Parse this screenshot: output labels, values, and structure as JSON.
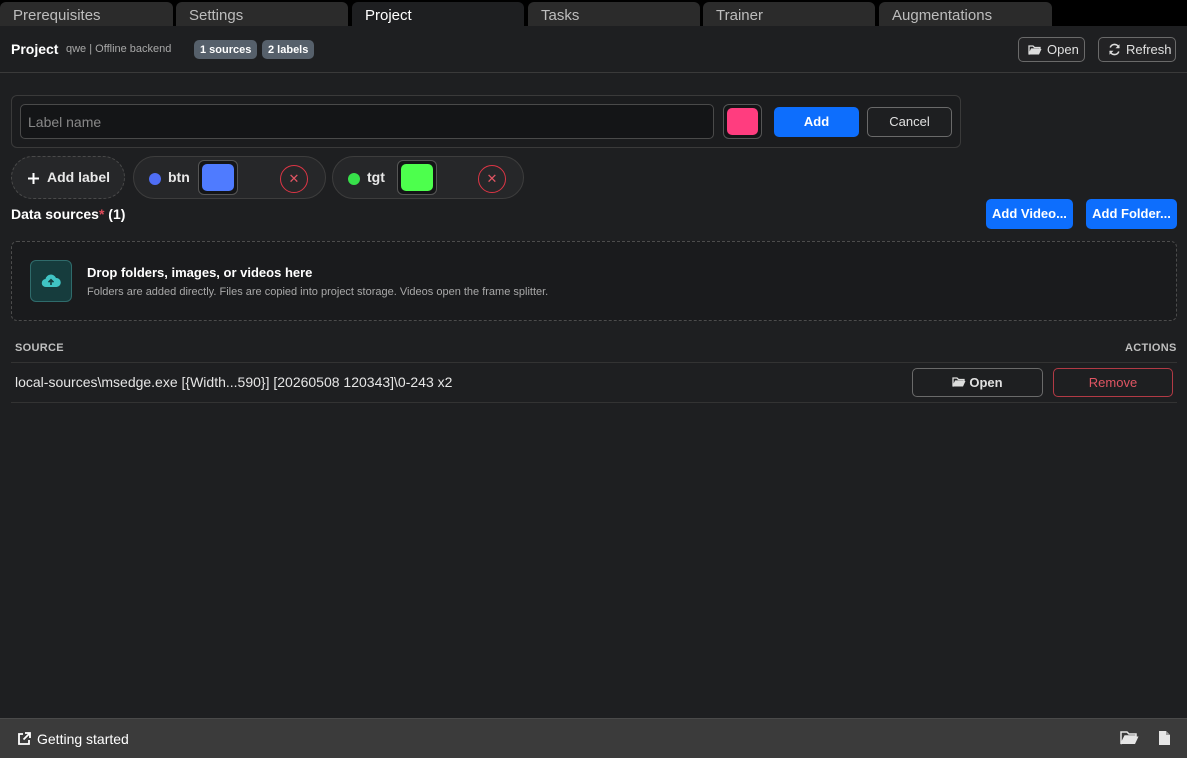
{
  "tabs": [
    "Prerequisites",
    "Settings",
    "Project",
    "Tasks",
    "Trainer",
    "Augmentations"
  ],
  "header": {
    "title": "Project",
    "subtitle": "qwe | Offline backend",
    "sources_badge": "1 sources",
    "labels_badge": "2 labels",
    "open_label": "Open",
    "refresh_label": "Refresh"
  },
  "label_editor": {
    "placeholder": "Label name",
    "value": "",
    "color": "#ff3d7f",
    "add_label": "Add",
    "cancel_label": "Cancel"
  },
  "add_label_chip": "Add label",
  "labels": [
    {
      "name": "btn",
      "dot_color": "#4f6ef5",
      "swatch_color": "#4f7bff"
    },
    {
      "name": "tgt",
      "dot_color": "#37e04a",
      "swatch_color": "#4dff4d"
    }
  ],
  "data_sources": {
    "title": "Data sources",
    "required_mark": "*",
    "count": "(1)",
    "add_video": "Add Video...",
    "add_folder": "Add Folder...",
    "dropzone_title": "Drop folders, images, or videos here",
    "dropzone_subtitle": "Folders are added directly. Files are copied into project storage. Videos open the frame splitter.",
    "columns": {
      "source": "SOURCE",
      "actions": "ACTIONS"
    },
    "rows": [
      {
        "source": "local-sources\\msedge.exe [{Width...590}] [20260508 120343]\\0-243 x2",
        "open": "Open",
        "remove": "Remove"
      }
    ]
  },
  "footer": {
    "getting_started": "Getting started"
  },
  "colors": {
    "accent": "#0d6efd",
    "danger": "#dc3545",
    "background": "#1e1f21"
  }
}
